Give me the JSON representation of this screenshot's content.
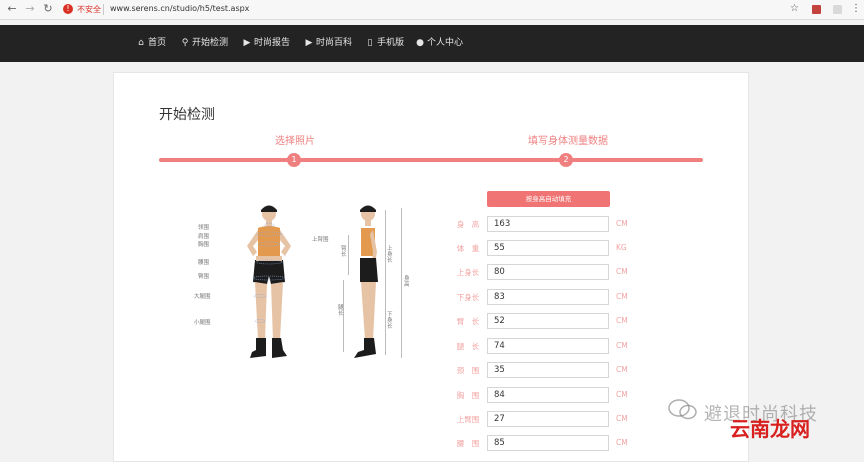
{
  "browser": {
    "insecure_label": "不安全",
    "url": "www.serens.cn/studio/h5/test.aspx"
  },
  "nav": [
    {
      "label": "首页",
      "icon": "home-icon"
    },
    {
      "label": "开始检测",
      "icon": "search-icon"
    },
    {
      "label": "时尚报告",
      "icon": "play-icon"
    },
    {
      "label": "时尚百科",
      "icon": "play-icon"
    },
    {
      "label": "手机版",
      "icon": "mobile-icon"
    },
    {
      "label": "个人中心",
      "icon": "user-icon"
    }
  ],
  "page": {
    "title": "开始检测",
    "steps": [
      {
        "label": "选择照片",
        "number": "1"
      },
      {
        "label": "填写身体测量数据",
        "number": "2"
      }
    ]
  },
  "illustration": {
    "front_labels": [
      "领围",
      "肩围",
      "胸围",
      "腰围",
      "臀围",
      "大腿围",
      "小腿围"
    ],
    "side_labels": [
      "上臂围",
      "臂长",
      "腿长",
      "上身长",
      "下身长",
      "身高"
    ]
  },
  "form": {
    "auto_fill_label": "按身高自动填充",
    "fields": [
      {
        "label": "身　高",
        "value": "163",
        "unit": "CM"
      },
      {
        "label": "体　重",
        "value": "55",
        "unit": "KG"
      },
      {
        "label": "上身长",
        "value": "80",
        "unit": "CM"
      },
      {
        "label": "下身长",
        "value": "83",
        "unit": "CM"
      },
      {
        "label": "臂　长",
        "value": "52",
        "unit": "CM"
      },
      {
        "label": "腿　长",
        "value": "74",
        "unit": "CM"
      },
      {
        "label": "颈　围",
        "value": "35",
        "unit": "CM"
      },
      {
        "label": "胸　围",
        "value": "84",
        "unit": "CM"
      },
      {
        "label": "上臂围",
        "value": "27",
        "unit": "CM"
      },
      {
        "label": "腰　围",
        "value": "85",
        "unit": "CM"
      }
    ]
  },
  "watermark": {
    "line1": "避退时尚科技",
    "line2": "云南龙网"
  }
}
